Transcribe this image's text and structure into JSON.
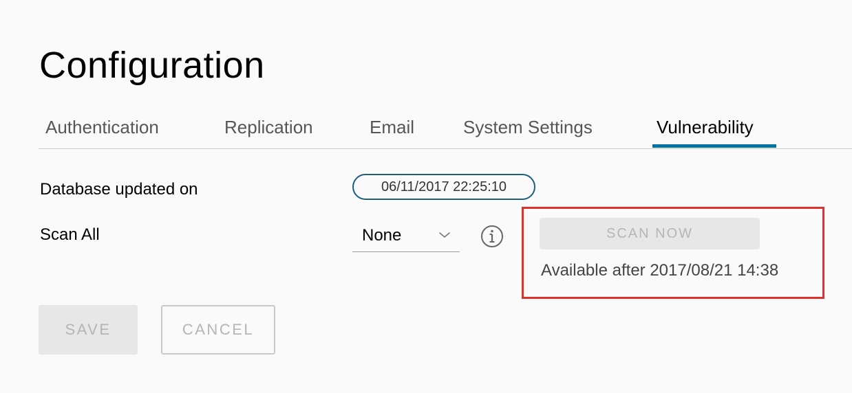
{
  "page": {
    "title": "Configuration"
  },
  "tabs": [
    {
      "label": "Authentication",
      "active": false
    },
    {
      "label": "Replication",
      "active": false
    },
    {
      "label": "Email",
      "active": false
    },
    {
      "label": "System Settings",
      "active": false
    },
    {
      "label": "Vulnerability",
      "active": true
    }
  ],
  "vulnerability": {
    "database_label": "Database updated on",
    "database_updated": "06/11/2017 22:25:10",
    "scan_all_label": "Scan All",
    "scan_all_value": "None",
    "scan_now_label": "SCAN NOW",
    "available_text": "Available after 2017/08/21 14:38"
  },
  "actions": {
    "save_label": "SAVE",
    "cancel_label": "CANCEL"
  },
  "colors": {
    "accent": "#0072a3",
    "pill_border": "#1a5e80",
    "highlight": "#e0312d",
    "disabled_bg": "#e7e7e7",
    "disabled_text": "#b5b5b5"
  },
  "icons": {
    "scan_select": "chevron-down-icon",
    "scan_info": "info-icon"
  }
}
